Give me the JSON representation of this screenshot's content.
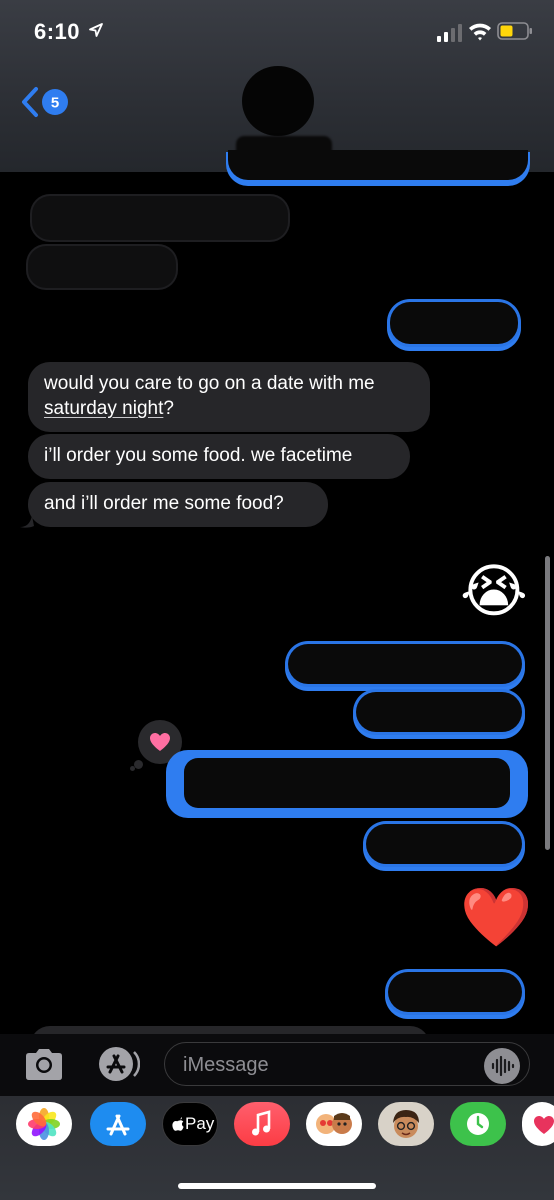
{
  "status_bar": {
    "time": "6:10"
  },
  "header": {
    "back_badge": "5"
  },
  "messages": {
    "received_1_line1": "would you care to go on a date with me",
    "received_1_line2_link": "saturday night",
    "received_1_line2_tail": "?",
    "received_2": "i’ll order you some food. we facetime",
    "received_3": "and i’ll order me some food?"
  },
  "reactions": {
    "heart_reaction_icon": "pink-heart-icon"
  },
  "emojis": {
    "crying": "😭",
    "heart": "❤️"
  },
  "input": {
    "placeholder": "iMessage"
  },
  "app_drawer": {
    "apple_pay_label": "Pay"
  },
  "colors": {
    "blue_bubble": "#2f7df0",
    "gray_bubble": "#262629",
    "badge": "#2f7df0"
  }
}
